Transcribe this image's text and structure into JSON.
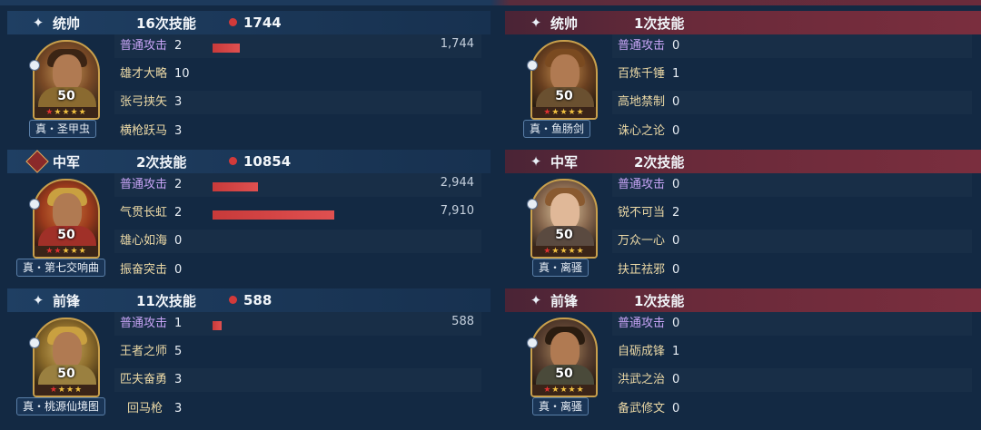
{
  "left": {
    "sections": [
      {
        "role": "统帅",
        "skill_count": "16次技能",
        "damage_total": "1744",
        "level": "50",
        "gear": "真・圣甲虫",
        "skills": [
          {
            "name": "普通攻击",
            "count": "2",
            "bar_value": 1744,
            "bar_label": "1,744"
          },
          {
            "name": "雄才大略",
            "count": "10"
          },
          {
            "name": "张弓挟矢",
            "count": "3"
          },
          {
            "name": "横枪跃马",
            "count": "3"
          }
        ]
      },
      {
        "role": "中军",
        "skill_count": "2次技能",
        "damage_total": "10854",
        "level": "50",
        "gear": "真・第七交响曲",
        "skills": [
          {
            "name": "普通攻击",
            "count": "2",
            "bar_value": 2944,
            "bar_label": "2,944"
          },
          {
            "name": "气贯长虹",
            "count": "2",
            "bar_value": 7910,
            "bar_label": "7,910"
          },
          {
            "name": "雄心如海",
            "count": "0"
          },
          {
            "name": "振奋突击",
            "count": "0"
          }
        ]
      },
      {
        "role": "前锋",
        "skill_count": "11次技能",
        "damage_total": "588",
        "level": "50",
        "gear": "真・桃源仙境图",
        "skills": [
          {
            "name": "普通攻击",
            "count": "1",
            "bar_value": 588,
            "bar_label": "588"
          },
          {
            "name": "王者之师",
            "count": "5"
          },
          {
            "name": "匹夫奋勇",
            "count": "3"
          },
          {
            "name": "回马枪",
            "count": "3"
          }
        ]
      }
    ]
  },
  "right": {
    "sections": [
      {
        "role": "统帅",
        "skill_count": "1次技能",
        "level": "50",
        "gear": "真・鱼肠剑",
        "skills": [
          {
            "name": "普通攻击",
            "count": "0"
          },
          {
            "name": "百炼千锤",
            "count": "1"
          },
          {
            "name": "高地禁制",
            "count": "0"
          },
          {
            "name": "诛心之论",
            "count": "0"
          }
        ]
      },
      {
        "role": "中军",
        "skill_count": "2次技能",
        "level": "50",
        "gear": "真・离骚",
        "skills": [
          {
            "name": "普通攻击",
            "count": "0"
          },
          {
            "name": "锐不可当",
            "count": "2"
          },
          {
            "name": "万众一心",
            "count": "0"
          },
          {
            "name": "扶正祛邪",
            "count": "0"
          }
        ]
      },
      {
        "role": "前锋",
        "skill_count": "1次技能",
        "level": "50",
        "gear": "真・离骚",
        "skills": [
          {
            "name": "普通攻击",
            "count": "0"
          },
          {
            "name": "自砺成锋",
            "count": "1"
          },
          {
            "name": "洪武之治",
            "count": "0"
          },
          {
            "name": "备武修文",
            "count": "0"
          }
        ]
      }
    ]
  },
  "bar_scale_max": 7910,
  "colors": {
    "background": "#132943",
    "left_header": "#1f3f63",
    "right_header": "#6a2a3a",
    "damage_bar": "#c83a3a",
    "basic_attack_text": "#c7a4f6",
    "skill_text": "#ecd9a6"
  },
  "icons": {
    "role_sparkle": "sparkle-icon",
    "role_diamond": "diamond-icon",
    "damage_dot": "damage-dot-icon"
  }
}
